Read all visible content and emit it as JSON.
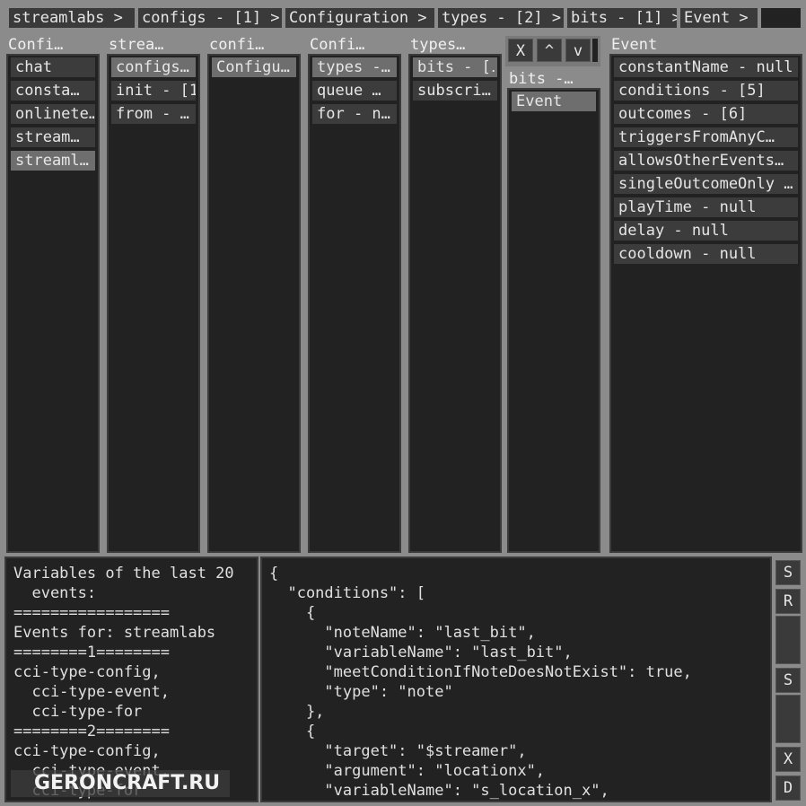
{
  "breadcrumb": [
    "streamlabs >",
    "configs - [1] >",
    "Configuration >",
    "types - [2] >",
    "bits - [1] >",
    "Event >"
  ],
  "columns": {
    "col1": {
      "title": "Confi…",
      "items": [
        "chat",
        "consta…",
        "onlinete…",
        "stream…",
        "streaml…"
      ]
    },
    "col2": {
      "title": "strea…",
      "items": [
        "configs…",
        "init - [1]",
        "from - …"
      ]
    },
    "col3": {
      "title": "confi…",
      "items": [
        "Configu…"
      ]
    },
    "col4": {
      "title": "Confi…",
      "items": [
        "types -…",
        "queue …",
        "for - n…"
      ]
    },
    "col5": {
      "title": "types…",
      "items": [
        "bits - [‥",
        "subscri…"
      ]
    },
    "col6": {
      "title": "bits -…",
      "items": [
        "Event"
      ]
    },
    "event": {
      "title": "Event",
      "items": [
        "constantName - null",
        "conditions - [5]",
        "outcomes - [6]",
        "triggersFromAnyC…",
        "allowsOtherEvents…",
        "singleOutcomeOnly …",
        "playTime - null",
        "delay - null",
        "cooldown - null"
      ]
    }
  },
  "controls": {
    "close": "X",
    "up": "^",
    "down": "v"
  },
  "variables_panel": {
    "lines": [
      "Variables of the last 20",
      "  events:",
      "=================",
      "Events for: streamlabs",
      "========1========",
      "cci-type-config,",
      "  cci-type-event,",
      "  cci-type-for",
      "========2========",
      "cci-type-config,",
      "  cci-type-event,",
      "  cci-type-for"
    ]
  },
  "json_editor": {
    "lines": [
      "{",
      "  \"conditions\": [",
      "    {",
      "      \"noteName\": \"last_bit\",",
      "      \"variableName\": \"last_bit\",",
      "      \"meetConditionIfNoteDoesNotExist\": true,",
      "      \"type\": \"note\"",
      "    },",
      "    {",
      "      \"target\": \"$streamer\",",
      "      \"argument\": \"locationx\",",
      "      \"variableName\": \"s_location_x\","
    ]
  },
  "side_buttons": [
    "S",
    "R",
    "",
    "S",
    "",
    "X",
    "D"
  ],
  "watermark": "GERONCRAFT.RU"
}
